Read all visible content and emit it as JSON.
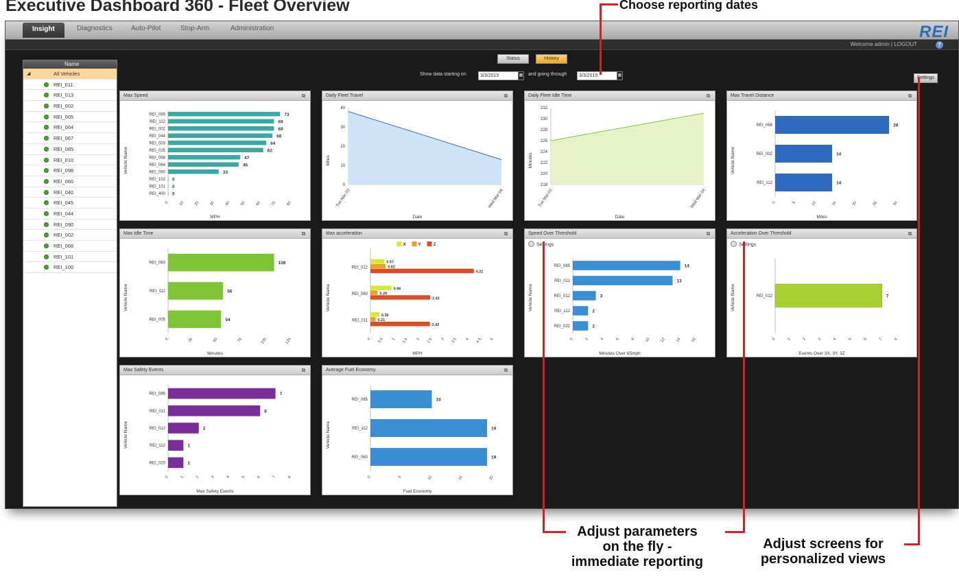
{
  "headline": "Executive Dashboard 360 - Fleet Overview",
  "callouts": {
    "dates": "Choose reporting dates",
    "params_line1": "Adjust parameters",
    "params_line2": "on the fly -",
    "params_line3": "immediate reporting",
    "screens_line1": "Adjust screens for",
    "screens_line2": "personalized views"
  },
  "nav": {
    "tabs": [
      "Insight",
      "Diagnostics",
      "Auto-Pilot",
      "Stop-Arm",
      "Administration"
    ],
    "active_tab": "Insight",
    "logo": "REI",
    "welcome": "Welcome admin  |  LOGOUT",
    "help": "?"
  },
  "sidebar": {
    "header": "Name",
    "all_label": "All Vehicles",
    "vehicles": [
      "REI_011",
      "REI_013",
      "REI_002",
      "REI_005",
      "REI_064",
      "REI_067",
      "REI_085",
      "REI_010",
      "REI_098",
      "REI_060",
      "REI_040",
      "REI_045",
      "REI_044",
      "REI_090",
      "REI_002",
      "REI_066",
      "REI_101",
      "REI_100"
    ]
  },
  "controls": {
    "toggle_status": "Status",
    "toggle_history": "History",
    "show_data_label": "Show data starting on",
    "start_date": "3/3/2015",
    "going_through_label": "and going through",
    "end_date": "3/3/2015",
    "settings": "Settings"
  },
  "colors": {
    "teal": "#3aa9a3",
    "blue": "#2e6bc0",
    "green": "#7ec434",
    "purple": "#7a2e9a",
    "skyblue": "#3a8fd4",
    "yellow": "#d9e73a",
    "orange": "#f0a020",
    "red": "#e04a24",
    "lime": "#a8d030",
    "area_blue": "#cfe3f6",
    "area_green": "#e6f3c8"
  },
  "icons": {
    "panel_popout": "popout-icon",
    "settings_knob": "settings-knob-icon",
    "calendar": "calendar-icon",
    "help": "help-icon"
  },
  "panels": {
    "settings_label": "Settings"
  },
  "chart_data": [
    {
      "id": "max_speed",
      "type": "bar",
      "title": "Max Speed",
      "categories": [
        "REI_085",
        "REI_112",
        "REI_002",
        "REI_044",
        "REI_003",
        "REI_025",
        "REI_068",
        "REI_064",
        "REI_060",
        "REI_102",
        "REI_101",
        "REI_400"
      ],
      "values": [
        73,
        69,
        69,
        68,
        64,
        62,
        47,
        46,
        33,
        0,
        0,
        0
      ],
      "xlim": [
        0,
        80
      ],
      "xticks": [
        0,
        10,
        20,
        30,
        40,
        50,
        60,
        70,
        80
      ],
      "xlabel": "MPH",
      "ylabel": "Vehicle Name"
    },
    {
      "id": "daily_fleet_travel",
      "type": "area",
      "title": "Daily Fleet Travel",
      "x": [
        "Tue Mar 03",
        "Wed Mar 04"
      ],
      "values": [
        38,
        13
      ],
      "ylim": [
        0,
        40
      ],
      "yticks": [
        0,
        10,
        20,
        30,
        40
      ],
      "xlabel": "Date",
      "ylabel": "Miles"
    },
    {
      "id": "daily_fleet_idle",
      "type": "area",
      "title": "Daily Fleet Idle Time",
      "x": [
        "Tue Mar 03",
        "Wed Mar 04"
      ],
      "values": [
        226,
        231
      ],
      "ylim": [
        218,
        232
      ],
      "yticks": [
        218,
        220,
        222,
        224,
        226,
        228,
        230,
        232
      ],
      "xlabel": "Date",
      "ylabel": "Minutes"
    },
    {
      "id": "max_travel_distance",
      "type": "bar",
      "title": "Max Travel Distance",
      "categories": [
        "REI_068",
        "REI_002",
        "REI_112"
      ],
      "values": [
        28,
        14,
        14
      ],
      "xlim": [
        0,
        30
      ],
      "xticks": [
        0,
        5,
        10,
        15,
        20,
        25,
        30
      ],
      "xlabel": "Miles",
      "ylabel": "Vehicle Name"
    },
    {
      "id": "max_idle_time",
      "type": "bar",
      "title": "Max Idle Time",
      "categories": [
        "REI_060",
        "REI_112",
        "REI_005"
      ],
      "values": [
        108,
        56,
        54
      ],
      "xlim": [
        0,
        125
      ],
      "xticks": [
        0,
        25,
        50,
        75,
        100,
        125
      ],
      "xlabel": "Minutes",
      "ylabel": "Vehicle Name"
    },
    {
      "id": "max_acceleration",
      "type": "bar",
      "title": "Max acceleration",
      "categories": [
        "REI_012",
        "REI_080",
        "REI_011"
      ],
      "series": [
        {
          "name": "X",
          "values": [
            0.57,
            0.86,
            0.36
          ]
        },
        {
          "name": "Y",
          "values": [
            0.62,
            0.29,
            0.21
          ]
        },
        {
          "name": "Z",
          "values": [
            4.21,
            2.43,
            2.42
          ]
        }
      ],
      "value_labels": [
        [
          "0.57",
          "0.62",
          "4.21"
        ],
        [
          "0.86",
          "0.29",
          "2.43"
        ],
        [
          "0.36",
          "0.21",
          "2.42"
        ]
      ],
      "xlim": [
        0,
        5
      ],
      "xticks": [
        0,
        0.5,
        1,
        1.5,
        2,
        2.5,
        3,
        3.5,
        4,
        4.5,
        5
      ],
      "xlabel": "MPH",
      "ylabel": "Vehicle Name"
    },
    {
      "id": "speed_over_threshold",
      "type": "bar",
      "title": "Speed Over Threshold",
      "categories": [
        "REI_085",
        "REI_011",
        "REI_012",
        "REI_112",
        "REI_022"
      ],
      "values": [
        14,
        13,
        3,
        2,
        2
      ],
      "xlim": [
        0,
        16
      ],
      "xticks": [
        0,
        2,
        4,
        6,
        8,
        10,
        12,
        14,
        16
      ],
      "xlabel": "Minutes Over 65mph",
      "ylabel": "Vehicle Name"
    },
    {
      "id": "acceleration_over_threshold",
      "type": "bar",
      "title": "Acceleration Over Threshold",
      "categories": [
        "REI_012"
      ],
      "values": [
        7
      ],
      "xlim": [
        0,
        8
      ],
      "xticks": [
        0,
        1,
        2,
        3,
        4,
        5,
        6,
        7,
        8
      ],
      "xlabel": "Events Over 3X, 3Y, 3Z",
      "ylabel": "Vehicle Name"
    },
    {
      "id": "max_safety_events",
      "type": "bar",
      "title": "Max Safety Events",
      "categories": [
        "REI_085",
        "REI_011",
        "REI_012",
        "REI_112",
        "REI_020"
      ],
      "values": [
        7,
        6,
        2,
        1,
        1
      ],
      "xlim": [
        0,
        8
      ],
      "xticks": [
        0,
        1,
        2,
        3,
        4,
        5,
        6,
        7,
        8
      ],
      "xlabel": "Max Safety Events",
      "ylabel": "Vehicle Name"
    },
    {
      "id": "average_fuel_economy",
      "type": "bar",
      "title": "Average Fuel Economy",
      "categories": [
        "REI_085",
        "REI_112",
        "REI_060"
      ],
      "values": [
        10,
        19,
        19
      ],
      "xlim": [
        0,
        20
      ],
      "xticks": [
        0,
        5,
        10,
        15,
        20
      ],
      "xlabel": "Fuel Economy",
      "ylabel": "Vehicle Name"
    }
  ]
}
